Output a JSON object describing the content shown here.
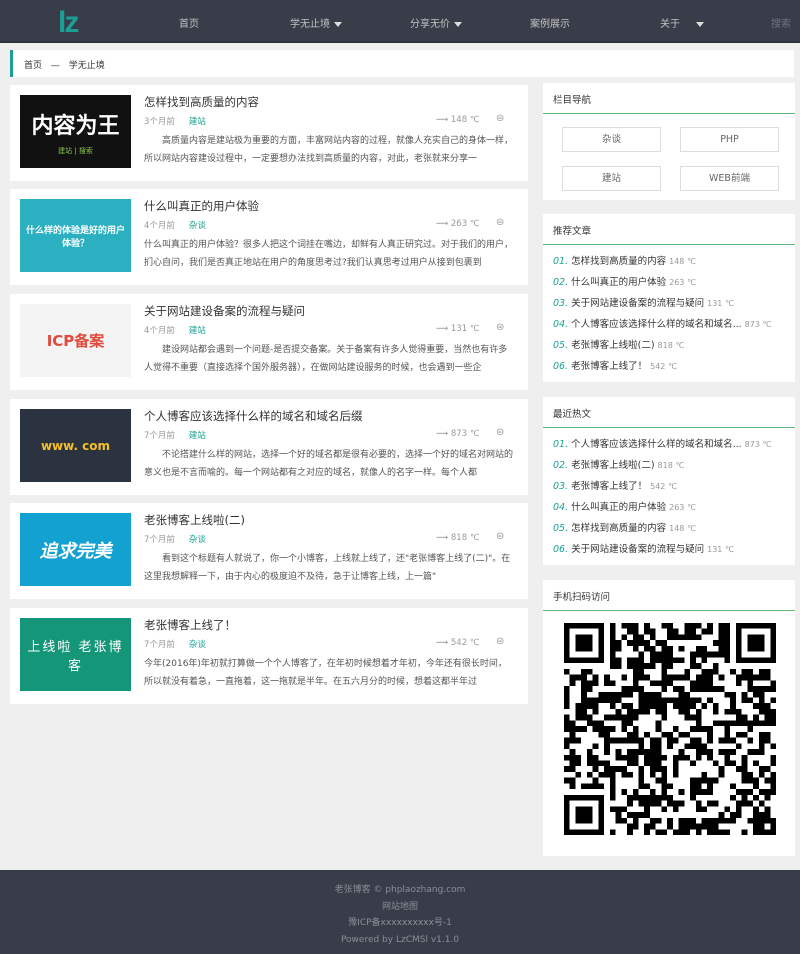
{
  "header": {
    "logo": "lz",
    "nav": [
      {
        "label": "首页"
      },
      {
        "label": "学无止境",
        "dropdown": true
      },
      {
        "label": "分享无价",
        "dropdown": true
      },
      {
        "label": "案例展示"
      },
      {
        "label": "关于",
        "dropdown": true
      }
    ],
    "search": "搜索"
  },
  "breadcrumb": {
    "home": "首页",
    "sep": "—",
    "current": "学无止境"
  },
  "articles": [
    {
      "title": "怎样找到高质量的内容",
      "time": "3个月前",
      "category": "建站",
      "heat": "148 ℃",
      "summary": "　　高质量内容是建站极为重要的方面，丰富网站内容的过程，就像人充实自己的身体一样，所以网站内容建设过程中，一定要想办法找到高质量的内容，对此，老张就来分享一",
      "thumb": "内容为王",
      "thumb_sub": "建站 | 搜索"
    },
    {
      "title": "什么叫真正的用户体验",
      "time": "4个月前",
      "category": "杂谈",
      "heat": "263 ℃",
      "summary": "什么叫真正的用户体验？很多人把这个词挂在嘴边，却鲜有人真正研究过。对于我们的用户，扪心自问，我们是否真正地站在用户的角度思考过?我们认真思考过用户从接到包裹到",
      "thumb": "什么样的体验是好的用户体验？"
    },
    {
      "title": "关于网站建设备案的流程与疑问",
      "time": "4个月前",
      "category": "建站",
      "heat": "131 ℃",
      "summary": "　　建设网站都会遇到一个问题-是否提交备案。关于备案有许多人觉得重要，当然也有许多人觉得不重要（直接选择个国外服务器），在做网站建设服务的时候，也会遇到一些企",
      "thumb": "ICP备案"
    },
    {
      "title": "个人博客应该选择什么样的域名和域名后缀",
      "time": "7个月前",
      "category": "建站",
      "heat": "873 ℃",
      "summary": "　　不论搭建什么样的网站，选择一个好的域名都是很有必要的，选择一个好的域名对网站的意义也是不言而喻的。每一个网站都有之对应的域名，就像人的名字一样。每个人都",
      "thumb": "www. com"
    },
    {
      "title": "老张博客上线啦(二)",
      "time": "7个月前",
      "category": "杂谈",
      "heat": "818 ℃",
      "summary": "　　看到这个标题有人就说了，你一个小博客，上线就上线了，还\"老张博客上线了(二)\"。在这里我想解释一下，由于内心的极度迫不及待，急于让博客上线，上一篇\"",
      "thumb": "追求完美"
    },
    {
      "title": "老张博客上线了！",
      "time": "7个月前",
      "category": "杂谈",
      "heat": "542 ℃",
      "summary": "今年(2016年)年初就打算做一个个人博客了，在年初时候想着才年初，今年还有很长时间，所以就没有着急，一直拖着，这一拖就是半年。在五六月分的时候，想着这都半年过",
      "thumb": "上线啦 老张博客"
    }
  ],
  "sidebar": {
    "category_nav": {
      "title": "栏目导航",
      "items": [
        "杂谈",
        "PHP",
        "建站",
        "WEB前端"
      ]
    },
    "recommended": {
      "title": "推荐文章",
      "items": [
        {
          "n": "01.",
          "t": "怎样找到高质量的内容",
          "h": "148 ℃"
        },
        {
          "n": "02.",
          "t": "什么叫真正的用户体验",
          "h": "263 ℃"
        },
        {
          "n": "03.",
          "t": "关于网站建设备案的流程与疑问",
          "h": "131 ℃"
        },
        {
          "n": "04.",
          "t": "个人博客应该选择什么样的域名和域名...",
          "h": "873 ℃"
        },
        {
          "n": "05.",
          "t": "老张博客上线啦(二)",
          "h": "818 ℃"
        },
        {
          "n": "06.",
          "t": "老张博客上线了！",
          "h": "542 ℃"
        }
      ]
    },
    "hot": {
      "title": "最近热文",
      "items": [
        {
          "n": "01.",
          "t": "个人博客应该选择什么样的域名和域名...",
          "h": "873 ℃"
        },
        {
          "n": "02.",
          "t": "老张博客上线啦(二)",
          "h": "818 ℃"
        },
        {
          "n": "03.",
          "t": "老张博客上线了！",
          "h": "542 ℃"
        },
        {
          "n": "04.",
          "t": "什么叫真正的用户体验",
          "h": "263 ℃"
        },
        {
          "n": "05.",
          "t": "怎样找到高质量的内容",
          "h": "148 ℃"
        },
        {
          "n": "06.",
          "t": "关于网站建设备案的流程与疑问",
          "h": "131 ℃"
        }
      ]
    },
    "qr": {
      "title": "手机扫码访问"
    }
  },
  "footer": {
    "copyright": "老张博客 ©  phplaozhang.com",
    "sitemap": "网站地图",
    "icp": "豫ICP备xxxxxxxxxx号-1",
    "powered": "Powered by LzCMSl v1.1.0"
  },
  "colors": {
    "accent": "#1aa094",
    "header": "#393d49"
  }
}
